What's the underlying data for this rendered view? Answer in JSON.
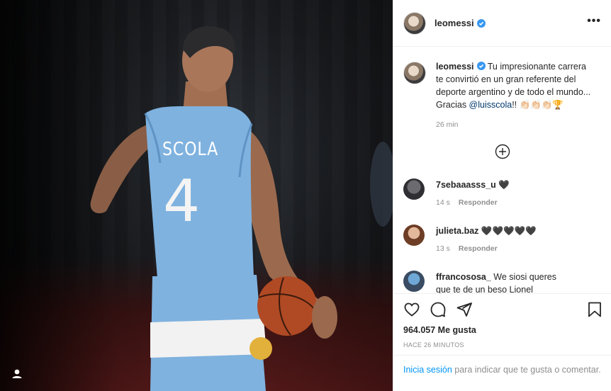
{
  "post": {
    "photo_alt": "",
    "jersey_name": "SCOLA",
    "jersey_number": "4"
  },
  "header": {
    "username": "leomessi",
    "more_label": "•••"
  },
  "caption": {
    "username": "leomessi",
    "text_before_mention": "Tu impresionante carrera te convirtió en un gran referente del deporte argentino y de todo el mundo... Gracias ",
    "mention": "@luisscola",
    "text_after_mention": "!! 👏🏻👏🏻👏🏻🏆",
    "time": "26 min"
  },
  "comments": [
    {
      "username": "7sebaaasss_u",
      "text": "🖤",
      "time": "14 s",
      "reply": "Responder"
    },
    {
      "username": "julieta.baz",
      "text": "🖤🖤🖤🖤🖤",
      "time": "13 s",
      "reply": "Responder"
    },
    {
      "username": "ffrancososa_",
      "text": "We siosi queres que te de un beso Lionel",
      "time": "",
      "reply": ""
    }
  ],
  "actions": {
    "likes": "964.057 Me gusta",
    "posted_ago": "HACE 26 MINUTOS"
  },
  "login_prompt": {
    "link": "Inicia sesión",
    "text": " para indicar que te gusta o comentar."
  },
  "colors": {
    "verified": "#3897f0",
    "link": "#0095f6",
    "mention": "#00376b",
    "muted": "#8e8e8e",
    "jersey": "#7fb2df"
  },
  "icons": {
    "verified": "verified-badge-icon",
    "like": "heart-icon",
    "comment": "comment-icon",
    "share": "paper-plane-icon",
    "save": "bookmark-icon",
    "load_more": "plus-circle-icon",
    "tagged": "user-tag-icon"
  }
}
